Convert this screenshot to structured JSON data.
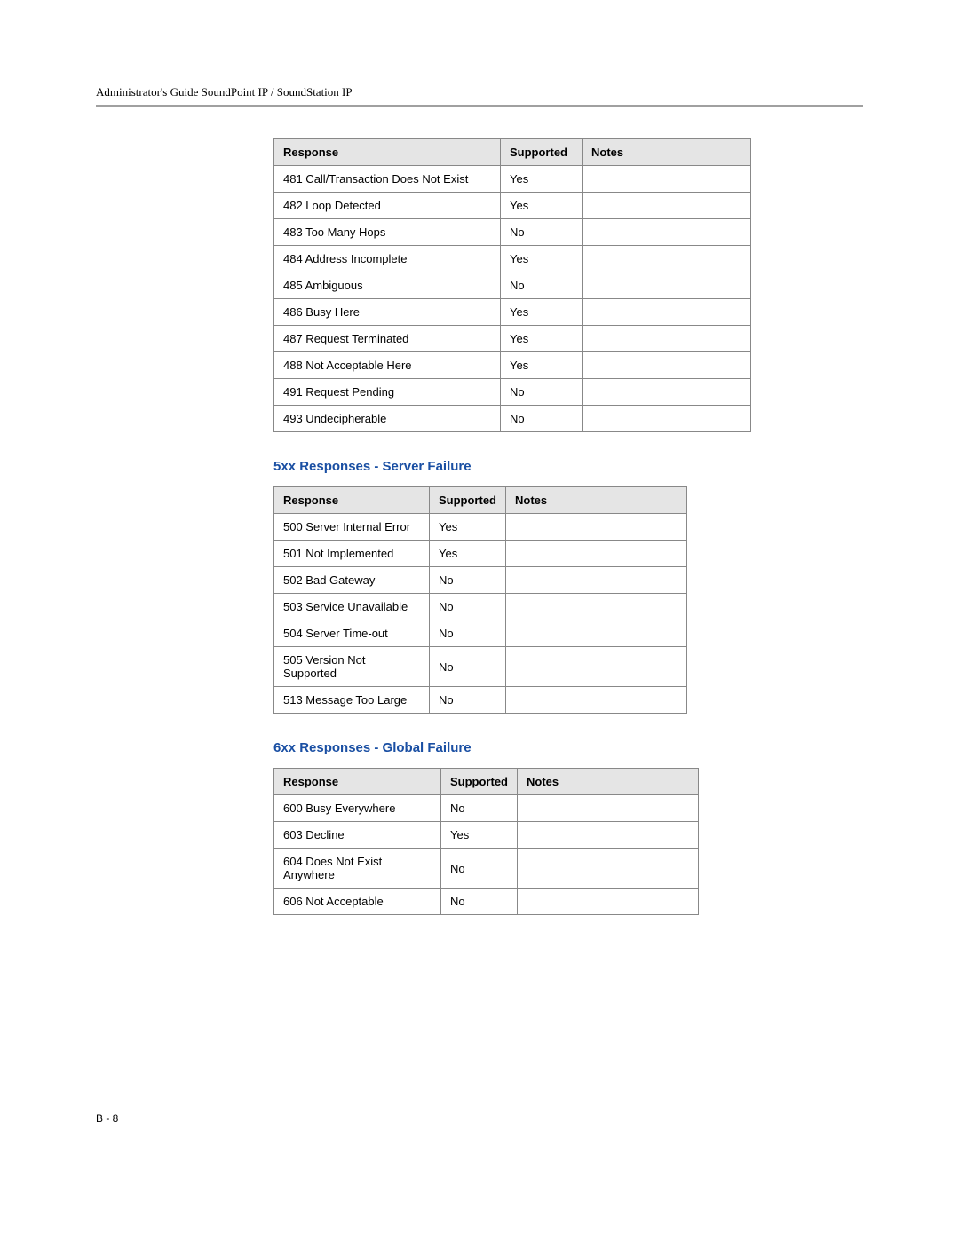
{
  "header_title": "Administrator's Guide SoundPoint IP / SoundStation IP",
  "footer": "B - 8",
  "tables": [
    {
      "heading": "",
      "headers": [
        "Response",
        "Supported",
        "Notes"
      ],
      "rows": [
        [
          "481 Call/Transaction Does Not Exist",
          "Yes",
          ""
        ],
        [
          "482 Loop Detected",
          "Yes",
          ""
        ],
        [
          "483 Too Many Hops",
          "No",
          ""
        ],
        [
          "484 Address Incomplete",
          "Yes",
          ""
        ],
        [
          "485 Ambiguous",
          "No",
          ""
        ],
        [
          "486 Busy Here",
          "Yes",
          ""
        ],
        [
          "487 Request Terminated",
          "Yes",
          ""
        ],
        [
          "488 Not Acceptable Here",
          "Yes",
          ""
        ],
        [
          "491 Request Pending",
          "No",
          ""
        ],
        [
          "493 Undecipherable",
          "No",
          ""
        ]
      ]
    },
    {
      "heading": "5xx Responses - Server Failure",
      "headers": [
        "Response",
        "Supported",
        "Notes"
      ],
      "rows": [
        [
          "500 Server Internal Error",
          "Yes",
          ""
        ],
        [
          "501 Not Implemented",
          "Yes",
          ""
        ],
        [
          "502 Bad Gateway",
          "No",
          ""
        ],
        [
          "503 Service Unavailable",
          "No",
          ""
        ],
        [
          "504 Server Time-out",
          "No",
          ""
        ],
        [
          "505 Version Not Supported",
          "No",
          ""
        ],
        [
          "513 Message Too Large",
          "No",
          ""
        ]
      ]
    },
    {
      "heading": "6xx Responses - Global Failure",
      "headers": [
        "Response",
        "Supported",
        "Notes"
      ],
      "rows": [
        [
          "600 Busy Everywhere",
          "No",
          ""
        ],
        [
          "603 Decline",
          "Yes",
          ""
        ],
        [
          "604 Does Not Exist Anywhere",
          "No",
          ""
        ],
        [
          "606 Not Acceptable",
          "No",
          ""
        ]
      ]
    }
  ]
}
